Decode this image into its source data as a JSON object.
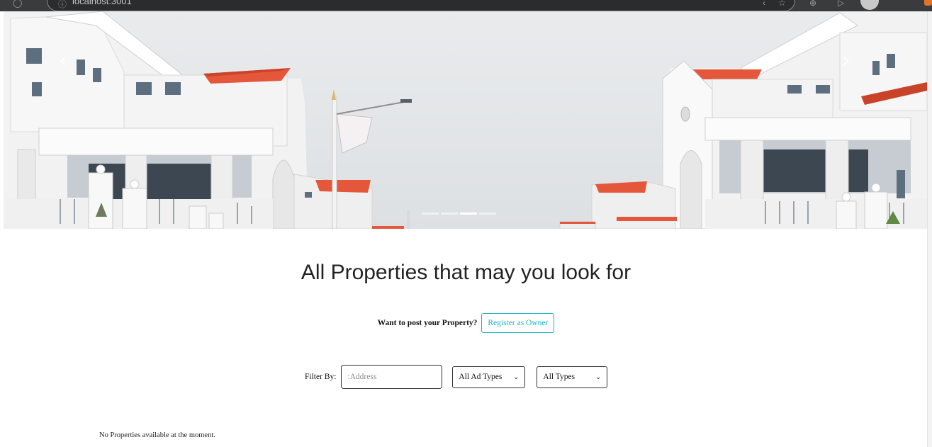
{
  "browser": {
    "address_text": "localhost:3001"
  },
  "hero": {
    "prev_arrow": "‹",
    "next_arrow": "›",
    "indicator_count": 4,
    "active_indicator": 2
  },
  "main": {
    "title": "All Properties that may you look for",
    "post_prompt": "Want to post your Property?",
    "register_label": "Register as Owner",
    "filter_label": "Filter By:",
    "address_placeholder": ":Address",
    "ad_type_selected": "All Ad Types",
    "type_selected": "All Types",
    "empty_message": "No Properties available at the moment."
  },
  "colors": {
    "accent": "#19b6c9",
    "roof": "#e4573a"
  }
}
